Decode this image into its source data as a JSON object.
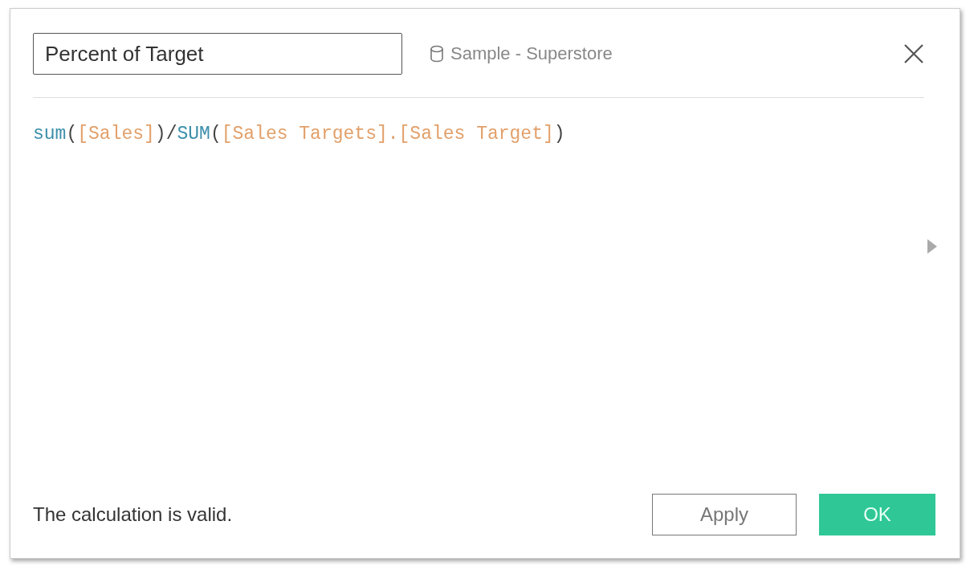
{
  "name_field": {
    "value": "Percent of Target"
  },
  "data_source": "Sample - Superstore",
  "formula": [
    {
      "kind": "function",
      "text": "sum"
    },
    {
      "kind": "punct",
      "text": "("
    },
    {
      "kind": "field",
      "text": "[Sales]"
    },
    {
      "kind": "punct",
      "text": ")/"
    },
    {
      "kind": "function",
      "text": "SUM"
    },
    {
      "kind": "punct",
      "text": "("
    },
    {
      "kind": "field",
      "text": "[Sales Targets].[Sales Target]"
    },
    {
      "kind": "punct",
      "text": ")"
    }
  ],
  "status": "The calculation is valid.",
  "buttons": [
    {
      "kind": "secondary",
      "label": "Apply"
    },
    {
      "kind": "primary",
      "label": "OK"
    }
  ]
}
